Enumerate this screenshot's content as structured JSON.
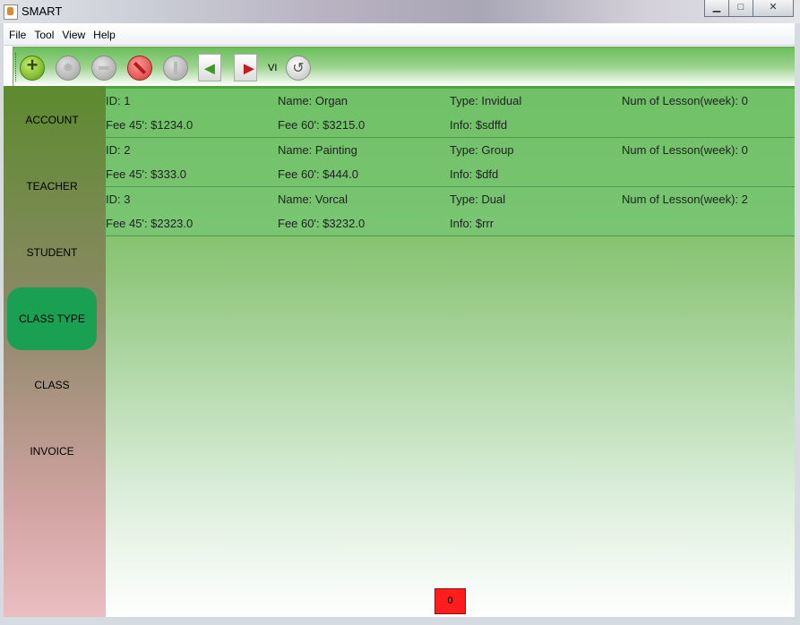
{
  "window": {
    "title": "SMART",
    "minimize": "▁",
    "maximize": "□",
    "close": "✕"
  },
  "menu": [
    "File",
    "Tool",
    "View",
    "Help"
  ],
  "toolbar": {
    "icons": [
      "add-icon",
      "gear-icon",
      "minus-icon",
      "stop-icon",
      "info-icon",
      "import-icon",
      "export-icon",
      "undo-icon"
    ],
    "language_label": "VI"
  },
  "sidebar": {
    "items": [
      "ACCOUNT",
      "TEACHER",
      "STUDENT",
      "CLASS TYPE",
      "CLASS",
      "INVOICE"
    ],
    "active": "CLASS TYPE"
  },
  "class_types": [
    {
      "id": "ID: 1",
      "name": "Name: Organ",
      "type": "Type: Invidual",
      "lessons": "Num of Lesson(week):  0",
      "fee45": "Fee 45': $1234.0",
      "fee60": "Fee 60': $3215.0",
      "info": "Info: $sdffd"
    },
    {
      "id": "ID: 2",
      "name": "Name: Painting",
      "type": "Type: Group",
      "lessons": "Num of Lesson(week):  0",
      "fee45": "Fee 45': $333.0",
      "fee60": "Fee 60': $444.0",
      "info": "Info: $dfd"
    },
    {
      "id": "ID: 3",
      "name": "Name: Vorcal",
      "type": "Type: Dual",
      "lessons": "Num of Lesson(week):  2",
      "fee45": "Fee 45': $2323.0",
      "fee60": "Fee 60': $3232.0",
      "info": "Info: $rrr"
    }
  ],
  "pagination": {
    "current": "0"
  },
  "colors": {
    "accent": "#1aa052",
    "badge": "#ff1d1d"
  }
}
